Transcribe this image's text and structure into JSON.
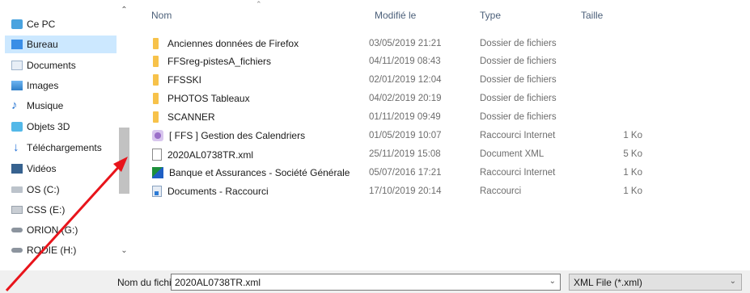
{
  "nav": {
    "items": [
      {
        "label": "Ce PC",
        "icon": "computer-icon",
        "selected": false
      },
      {
        "label": "Bureau",
        "icon": "desktop-icon",
        "selected": true
      },
      {
        "label": "Documents",
        "icon": "documents-icon",
        "selected": false
      },
      {
        "label": "Images",
        "icon": "pictures-icon",
        "selected": false
      },
      {
        "label": "Musique",
        "icon": "music-icon",
        "selected": false
      },
      {
        "label": "Objets 3D",
        "icon": "3d-objects-icon",
        "selected": false
      },
      {
        "label": "Téléchargements",
        "icon": "downloads-icon",
        "selected": false
      },
      {
        "label": "Vidéos",
        "icon": "videos-icon",
        "selected": false
      },
      {
        "label": "OS (C:)",
        "icon": "drive-icon",
        "selected": false
      },
      {
        "label": "CSS (E:)",
        "icon": "drive-icon",
        "selected": false
      },
      {
        "label": "ORION (G:)",
        "icon": "network-drive-icon",
        "selected": false
      },
      {
        "label": "RODIE (H:)",
        "icon": "network-drive-icon",
        "selected": false
      }
    ]
  },
  "columns": {
    "name": "Nom",
    "modified": "Modifié le",
    "type": "Type",
    "size": "Taille"
  },
  "files": [
    {
      "name": "Anciennes données de Firefox",
      "modified": "03/05/2019 21:21",
      "type": "Dossier de fichiers",
      "size": "",
      "icon": "folder-icon"
    },
    {
      "name": "FFSreg-pistesA_fichiers",
      "modified": "04/11/2019 08:43",
      "type": "Dossier de fichiers",
      "size": "",
      "icon": "folder-icon"
    },
    {
      "name": "FFSSKI",
      "modified": "02/01/2019 12:04",
      "type": "Dossier de fichiers",
      "size": "",
      "icon": "folder-icon"
    },
    {
      "name": "PHOTOS Tableaux",
      "modified": "04/02/2019 20:19",
      "type": "Dossier de fichiers",
      "size": "",
      "icon": "folder-icon"
    },
    {
      "name": "SCANNER",
      "modified": "01/11/2019 09:49",
      "type": "Dossier de fichiers",
      "size": "",
      "icon": "folder-icon"
    },
    {
      "name": "[ FFS ] Gestion des Calendriers",
      "modified": "01/05/2019 10:07",
      "type": "Raccourci Internet",
      "size": "1 Ko",
      "icon": "internet-shortcut-icon"
    },
    {
      "name": "2020AL0738TR.xml",
      "modified": "25/11/2019 15:08",
      "type": "Document XML",
      "size": "5 Ko",
      "icon": "xml-file-icon"
    },
    {
      "name": "Banque et Assurances - Société Générale",
      "modified": "05/07/2016 17:21",
      "type": "Raccourci Internet",
      "size": "1 Ko",
      "icon": "bank-shortcut-icon"
    },
    {
      "name": "Documents - Raccourci",
      "modified": "17/10/2019 20:14",
      "type": "Raccourci",
      "size": "1 Ko",
      "icon": "shortcut-icon"
    }
  ],
  "footer": {
    "filename_label": "Nom du fichier :",
    "filename_value": "2020AL0738TR.xml",
    "filetype_value": "XML File (*.xml)"
  },
  "colors": {
    "selection": "#cce8ff",
    "annotation_arrow": "#e8141b",
    "folder": "#f7c24a",
    "header_text": "#4c607a"
  }
}
